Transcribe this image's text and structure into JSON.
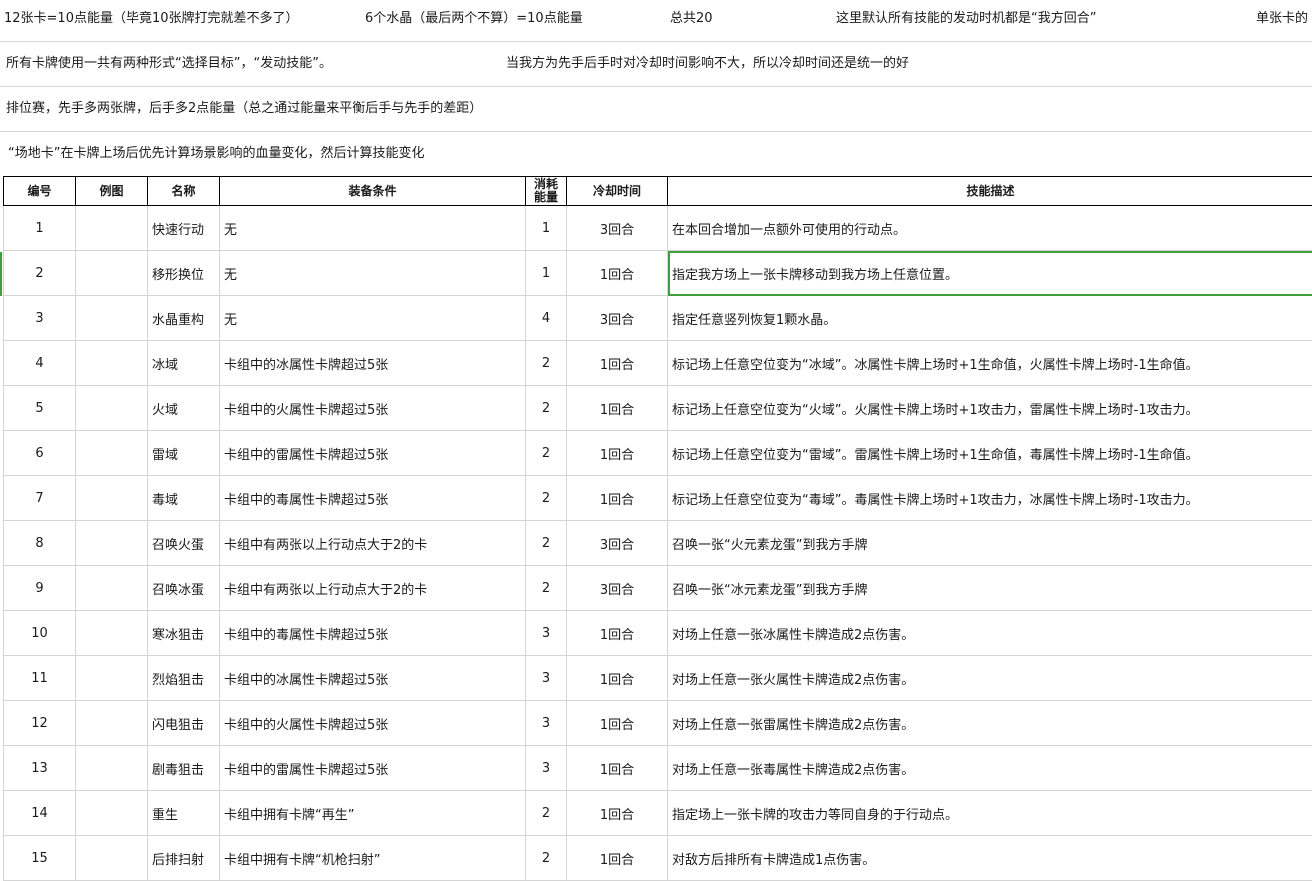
{
  "notes": {
    "row1": [
      "12张卡=10点能量（毕竟10张牌打完就差不多了）",
      "6个水晶（最后两个不算）=10点能量",
      "总共20",
      "这里默认所有技能的发动时机都是“我方回合”",
      "单张卡的"
    ],
    "row2": [
      "所有卡牌使用一共有两种形式“选择目标”，“发动技能”。",
      "当我方为先手后手时对冷却时间影响不大，所以冷却时间还是统一的好"
    ],
    "row3": "排位赛，先手多两张牌，后手多2点能量（总之通过能量来平衡后手与先手的差距）",
    "row4": "“场地卡”在卡牌上场后优先计算场景影响的血量变化，然后计算技能变化"
  },
  "table": {
    "headers": {
      "id": "编号",
      "image": "例图",
      "name": "名称",
      "condition": "装备条件",
      "cost_line1": "消耗",
      "cost_line2": "能量",
      "cooldown": "冷却时间",
      "desc": "技能描述"
    },
    "rows": [
      {
        "id": "1",
        "name": "快速行动",
        "condition": "无",
        "cost": "1",
        "cooldown": "3回合",
        "desc": "在本回合增加一点额外可使用的行动点。"
      },
      {
        "id": "2",
        "name": "移形换位",
        "condition": "无",
        "cost": "1",
        "cooldown": "1回合",
        "desc": "指定我方场上一张卡牌移动到我方场上任意位置。"
      },
      {
        "id": "3",
        "name": "水晶重构",
        "condition": "无",
        "cost": "4",
        "cooldown": "3回合",
        "desc": "指定任意竖列恢复1颗水晶。"
      },
      {
        "id": "4",
        "name": "冰域",
        "condition": "卡组中的冰属性卡牌超过5张",
        "cost": "2",
        "cooldown": "1回合",
        "desc": "标记场上任意空位变为“冰域”。冰属性卡牌上场时+1生命值，火属性卡牌上场时-1生命值。"
      },
      {
        "id": "5",
        "name": "火域",
        "condition": "卡组中的火属性卡牌超过5张",
        "cost": "2",
        "cooldown": "1回合",
        "desc": "标记场上任意空位变为“火域”。火属性卡牌上场时+1攻击力，雷属性卡牌上场时-1攻击力。"
      },
      {
        "id": "6",
        "name": "雷域",
        "condition": "卡组中的雷属性卡牌超过5张",
        "cost": "2",
        "cooldown": "1回合",
        "desc": "标记场上任意空位变为“雷域”。雷属性卡牌上场时+1生命值，毒属性卡牌上场时-1生命值。"
      },
      {
        "id": "7",
        "name": "毒域",
        "condition": "卡组中的毒属性卡牌超过5张",
        "cost": "2",
        "cooldown": "1回合",
        "desc": "标记场上任意空位变为“毒域”。毒属性卡牌上场时+1攻击力，冰属性卡牌上场时-1攻击力。"
      },
      {
        "id": "8",
        "name": "召唤火蛋",
        "condition": "卡组中有两张以上行动点大于2的卡",
        "cost": "2",
        "cooldown": "3回合",
        "desc": "召唤一张“火元素龙蛋”到我方手牌"
      },
      {
        "id": "9",
        "name": "召唤冰蛋",
        "condition": "卡组中有两张以上行动点大于2的卡",
        "cost": "2",
        "cooldown": "3回合",
        "desc": "召唤一张“冰元素龙蛋”到我方手牌"
      },
      {
        "id": "10",
        "name": "寒冰狙击",
        "condition": "卡组中的毒属性卡牌超过5张",
        "cost": "3",
        "cooldown": "1回合",
        "desc": "对场上任意一张冰属性卡牌造成2点伤害。"
      },
      {
        "id": "11",
        "name": "烈焰狙击",
        "condition": "卡组中的冰属性卡牌超过5张",
        "cost": "3",
        "cooldown": "1回合",
        "desc": "对场上任意一张火属性卡牌造成2点伤害。"
      },
      {
        "id": "12",
        "name": "闪电狙击",
        "condition": "卡组中的火属性卡牌超过5张",
        "cost": "3",
        "cooldown": "1回合",
        "desc": "对场上任意一张雷属性卡牌造成2点伤害。"
      },
      {
        "id": "13",
        "name": "剧毒狙击",
        "condition": "卡组中的雷属性卡牌超过5张",
        "cost": "3",
        "cooldown": "1回合",
        "desc": "对场上任意一张毒属性卡牌造成2点伤害。"
      },
      {
        "id": "14",
        "name": "重生",
        "condition": "卡组中拥有卡牌“再生”",
        "cost": "2",
        "cooldown": "1回合",
        "desc": "指定场上一张卡牌的攻击力等同自身的于行动点。"
      },
      {
        "id": "15",
        "name": "后排扫射",
        "condition": "卡组中拥有卡牌“机枪扫射”",
        "cost": "2",
        "cooldown": "1回合",
        "desc": "对敌方后排所有卡牌造成1点伤害。"
      }
    ]
  },
  "accent_color": "#3f9f3a"
}
